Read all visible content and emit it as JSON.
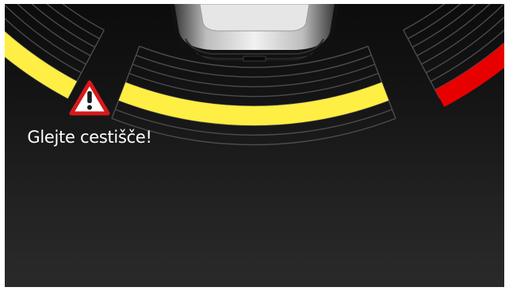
{
  "warning": {
    "icon": "warning-triangle-icon",
    "message": "Glejte cestišče!"
  },
  "sensors": {
    "rings_per_zone": 8,
    "active_colors": {
      "caution": "#ffee44",
      "danger": "#e60000"
    },
    "zones": [
      {
        "name": "rear-left",
        "alert_ring": 7,
        "level": "caution"
      },
      {
        "name": "rear-center",
        "alert_ring": 5,
        "level": "caution"
      },
      {
        "name": "rear-right",
        "alert_ring": 8,
        "level": "danger"
      }
    ]
  }
}
